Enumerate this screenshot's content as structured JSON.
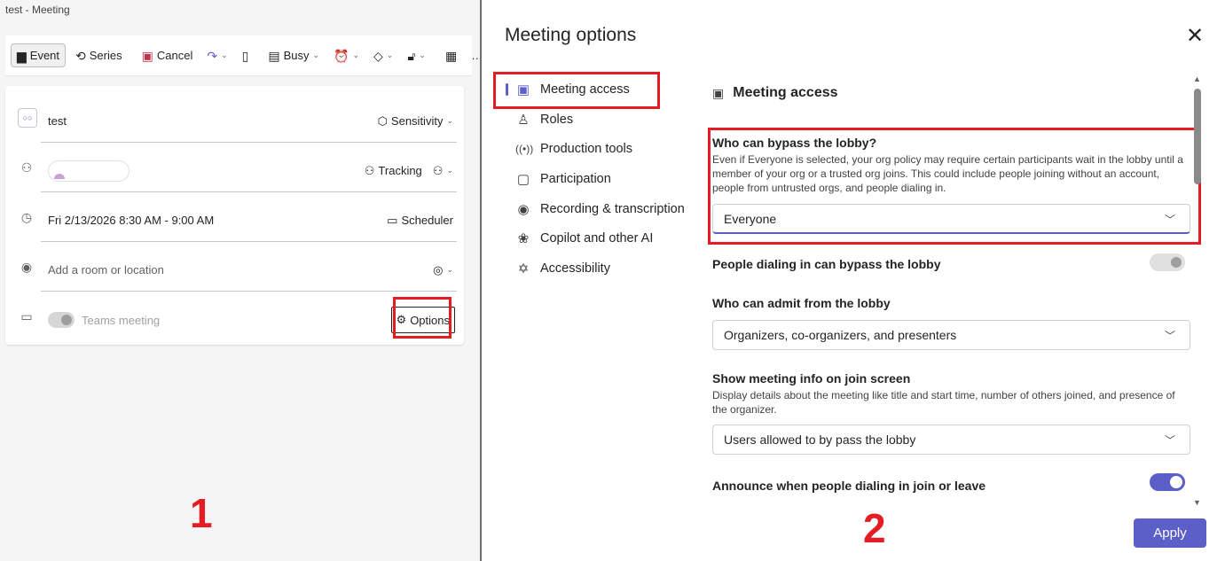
{
  "left_window": {
    "title": "test - Meeting",
    "toolbar": {
      "event": "Event",
      "series": "Series",
      "cancel": "Cancel",
      "busy": "Busy",
      "more": "…"
    },
    "form": {
      "title_value": "test",
      "sensitivity": "Sensitivity",
      "tracking": "Tracking",
      "datetime": "Fri 2/13/2026 8:30 AM - 9:00 AM",
      "scheduler": "Scheduler",
      "location_placeholder": "Add a room or location",
      "teams_meeting": "Teams meeting",
      "options": "Options"
    }
  },
  "annotations": {
    "step1": "1",
    "step2": "2"
  },
  "meeting_options": {
    "title": "Meeting options",
    "close": "✕",
    "nav": [
      {
        "label": "Meeting access",
        "icon": "person-card-icon"
      },
      {
        "label": "Roles",
        "icon": "person-icon"
      },
      {
        "label": "Production tools",
        "icon": "broadcast-icon"
      },
      {
        "label": "Participation",
        "icon": "chat-icon"
      },
      {
        "label": "Recording & transcription",
        "icon": "record-icon"
      },
      {
        "label": "Copilot and other AI",
        "icon": "copilot-icon"
      },
      {
        "label": "Accessibility",
        "icon": "accessibility-icon"
      }
    ],
    "section_title": "Meeting access",
    "bypass_lobby": {
      "label": "Who can bypass the lobby?",
      "description": "Even if Everyone is selected, your org policy may require certain participants wait in the lobby until a member of your org or a trusted org joins. This could include people joining without an account, people from untrusted orgs, and people dialing in.",
      "value": "Everyone"
    },
    "dialin_bypass": {
      "label": "People dialing in can bypass the lobby",
      "enabled": false
    },
    "admit_from_lobby": {
      "label": "Who can admit from the lobby",
      "value": "Organizers, co-organizers, and presenters"
    },
    "join_screen_info": {
      "label": "Show meeting info on join screen",
      "description": "Display details about the meeting like title and start time, number of others joined, and presence of the organizer.",
      "value": "Users allowed to by pass the lobby"
    },
    "announce_dialin": {
      "label": "Announce when people dialing in join or leave",
      "enabled": true
    },
    "apply": "Apply"
  },
  "colors": {
    "accent": "#5b5fc7",
    "annotation_red": "#e51c23"
  }
}
